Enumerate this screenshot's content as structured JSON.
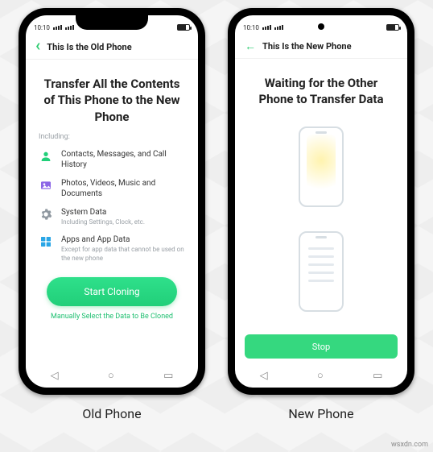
{
  "status": {
    "time": "10:10"
  },
  "old": {
    "header": "This Is the Old Phone",
    "headline": "Transfer All the Contents of This Phone to the New Phone",
    "including_label": "Including:",
    "items": [
      {
        "title": "Contacts, Messages, and Call History",
        "desc": ""
      },
      {
        "title": "Photos, Videos, Music and Documents",
        "desc": ""
      },
      {
        "title": "System Data",
        "desc": "Including Settings, Clock, etc."
      },
      {
        "title": "Apps and App Data",
        "desc": "Except for app data that cannot be used on the new phone"
      }
    ],
    "cta": "Start Cloning",
    "manual_link": "Manually Select the Data to Be Cloned",
    "caption": "Old Phone"
  },
  "new": {
    "header": "This Is the New Phone",
    "headline": "Waiting for the Other Phone to Transfer Data",
    "stop": "Stop",
    "caption": "New Phone"
  },
  "watermark": "wsxdn.com",
  "colors": {
    "accent": "#21cf79"
  }
}
